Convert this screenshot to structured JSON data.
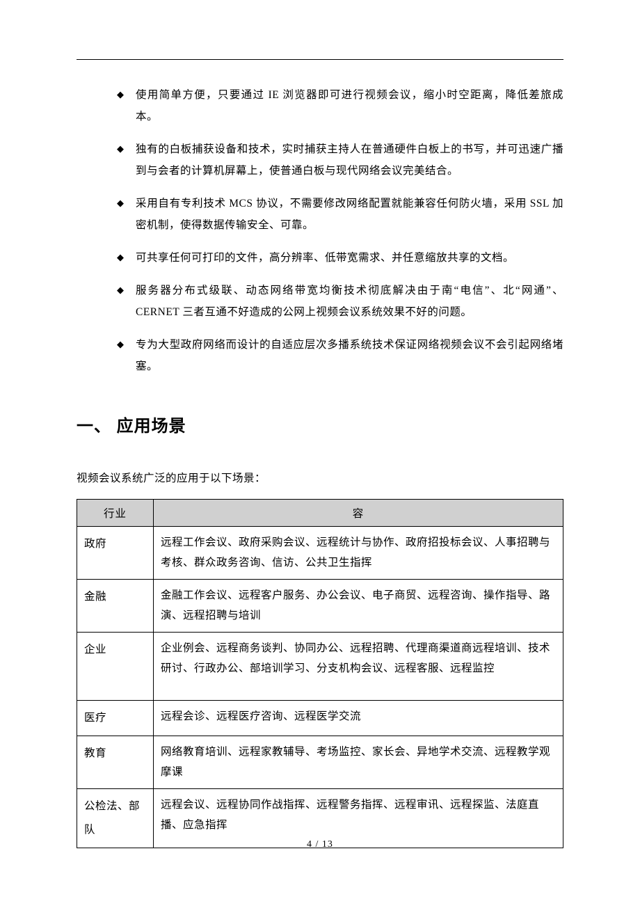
{
  "bullets": [
    "使用简单方便，只要通过 IE 浏览器即可进行视频会议，缩小时空距离，降低差旅成本。",
    "独有的白板捕获设备和技术，实时捕获主持人在普通硬件白板上的书写，并可迅速广播到与会者的计算机屏幕上，使普通白板与现代网络会议完美结合。",
    "采用自有专利技术 MCS 协议，不需要修改网络配置就能兼容任何防火墙，采用 SSL 加密机制，使得数据传输安全、可靠。",
    "可共享任何可打印的文件，高分辨率、低带宽需求、并任意缩放共享的文档。",
    "服务器分布式级联、动态网络带宽均衡技术彻底解决由于南“电信”、北“网通”、CERNET 三者互通不好造成的公网上视频会议系统效果不好的问题。",
    "专为大型政府网络而设计的自适应层次多播系统技术保证网络视频会议不会引起网络堵塞。"
  ],
  "heading": "一、 应用场景",
  "intro": "视频会议系统广泛的应用于以下场景：",
  "table": {
    "headers": [
      "行业",
      "容"
    ],
    "rows": [
      {
        "industry": "政府",
        "content": "远程工作会议、政府采购会议、远程统计与协作、政府招投标会议、人事招聘与考核、群众政务咨询、信访、公共卫生指挥"
      },
      {
        "industry": "金融",
        "content": "金融工作会议、远程客户服务、办公会议、电子商贸、远程咨询、操作指导、路演、远程招聘与培训"
      },
      {
        "industry": "企业",
        "content": "企业例会、远程商务谈判、协同办公、远程招聘、代理商渠道商远程培训、技术研讨、行政办公、部培训学习、分支机构会议、远程客服、远程监控"
      },
      {
        "industry": "医疗",
        "content": "远程会诊、远程医疗咨询、远程医学交流"
      },
      {
        "industry": "教育",
        "content": "网络教育培训、远程家教辅导、考场监控、家长会、异地学术交流、远程教学观摩课"
      },
      {
        "industry": "公检法、部队",
        "content": "远程会议、远程协同作战指挥、远程警务指挥、远程审讯、远程探监、法庭直播、应急指挥"
      }
    ]
  },
  "footer": "4  /  13"
}
